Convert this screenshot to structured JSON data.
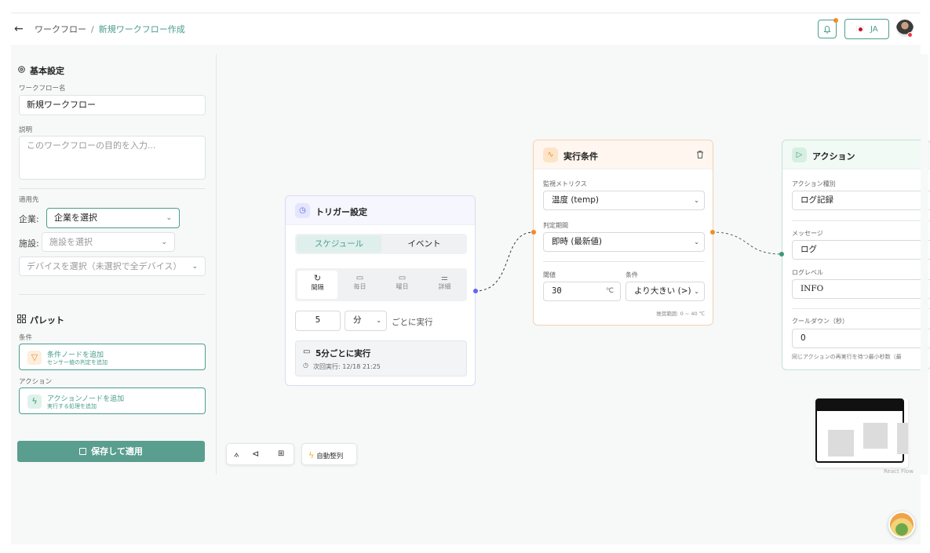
{
  "header": {
    "back_icon": "←",
    "breadcrumb_root": "ワークフロー",
    "breadcrumb_sep": "/",
    "breadcrumb_current": "新規ワークフロー作成",
    "lang_label": "JA"
  },
  "sidebar": {
    "basic_title": "基本設定",
    "name_label": "ワークフロー名",
    "name_value": "新規ワークフロー",
    "desc_label": "説明",
    "desc_placeholder": "このワークフローの目的を入力...",
    "target_label": "適用先",
    "company_label": "企業:",
    "company_value": "企業を選択",
    "facility_label": "施設:",
    "facility_value": "施設を選択",
    "device_value": "デバイスを選択（未選択で全デバイス）",
    "palette_title": "パレット",
    "condition_label": "条件",
    "condition_item_title": "条件ノードを追加",
    "condition_item_sub": "センサー値の判定を追加",
    "action_label": "アクション",
    "action_item_title": "アクションノードを追加",
    "action_item_sub": "実行する処理を追加",
    "save_label": "保存して適用"
  },
  "trigger": {
    "title": "トリガー設定",
    "tab_schedule": "スケジュール",
    "tab_event": "イベント",
    "modes": [
      "間隔",
      "毎日",
      "曜日",
      "詳細"
    ],
    "interval_value": "5",
    "unit_value": "分",
    "suffix": "ごとに実行",
    "summary": "5分ごとに実行",
    "next_run": "次回実行: 12/18 21:25"
  },
  "condition": {
    "title": "実行条件",
    "metric_label": "監視メトリクス",
    "metric_value": "温度 (temp)",
    "period_label": "判定期間",
    "period_value": "即時 (最新値)",
    "threshold_label": "閾値",
    "threshold_value": "30",
    "threshold_unit": "℃",
    "cond_label": "条件",
    "cond_value": "より大きい (>)",
    "range_hint": "推奨範囲: 0 ~ 40 ℃"
  },
  "action": {
    "title": "アクション",
    "type_label": "アクション種別",
    "type_value": "ログ記録",
    "message_label": "メッセージ",
    "message_value": "ログ",
    "level_label": "ログレベル",
    "level_value": "INFO",
    "cooldown_label": "クールダウン（秒）",
    "cooldown_value": "0",
    "cooldown_hint": "同じアクションの再実行を待つ最小秒数（最"
  },
  "canvas": {
    "auto_arrange": "自動整列",
    "attribution": "React Flow"
  },
  "colors": {
    "accent": "#4a9d8c",
    "trigger_accent": "#6366f1",
    "condition_accent": "#f08c28",
    "action_accent": "#3a9a73"
  }
}
